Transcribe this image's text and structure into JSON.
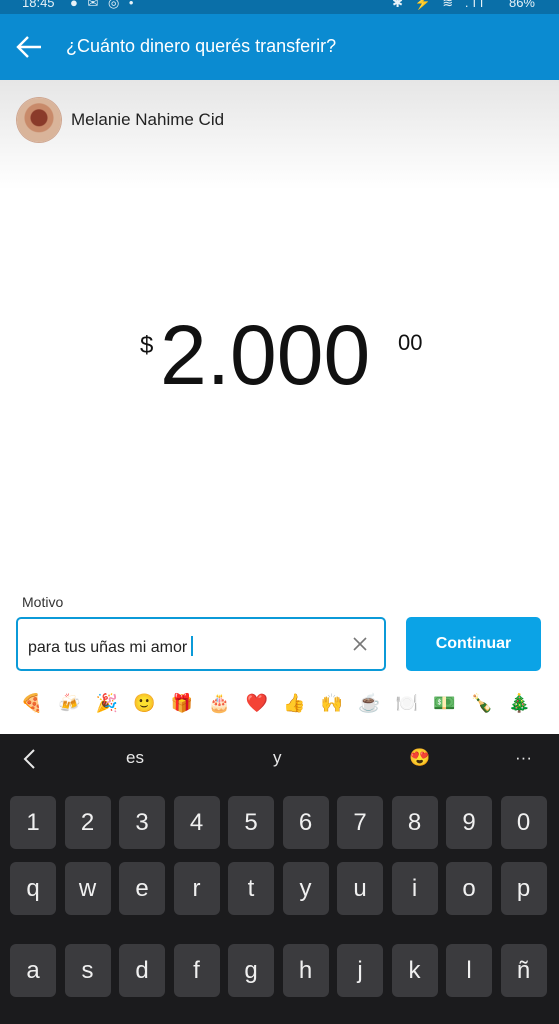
{
  "status_bar": {
    "time": "18:45",
    "left_icons": "● ✉ ◎ •",
    "right_icons": "✱ ⚡ ≋ .ıl",
    "battery": "86%"
  },
  "app_bar": {
    "back_icon": "arrow-left-icon",
    "title": "¿Cuánto dinero querés transferir?"
  },
  "recipient": {
    "name": "Melanie Nahime Cid"
  },
  "amount": {
    "currency": "$",
    "integer": "2.000",
    "cents": "00"
  },
  "motivo": {
    "label": "Motivo",
    "value": "para tus uñas mi amor"
  },
  "continue_label": "Continuar",
  "emojis": [
    "🍕",
    "🍻",
    "🎉",
    "🙂",
    "🎁",
    "🎂",
    "❤️",
    "👍",
    "🙌",
    "☕",
    "🍽️",
    "💵",
    "🍾",
    "🎄"
  ],
  "keyboard": {
    "suggestions": [
      "es",
      "y",
      "😍",
      "···"
    ],
    "row_numbers": [
      "1",
      "2",
      "3",
      "4",
      "5",
      "6",
      "7",
      "8",
      "9",
      "0"
    ],
    "row_top": [
      "q",
      "w",
      "e",
      "r",
      "t",
      "y",
      "u",
      "i",
      "o",
      "p"
    ],
    "row_middle": [
      "a",
      "s",
      "d",
      "f",
      "g",
      "h",
      "j",
      "k",
      "l",
      "ñ"
    ]
  },
  "colors": {
    "app_bar": "#0b8bd1",
    "accent": "#0ba3e6",
    "keyboard_bg": "#1b1b1d"
  }
}
